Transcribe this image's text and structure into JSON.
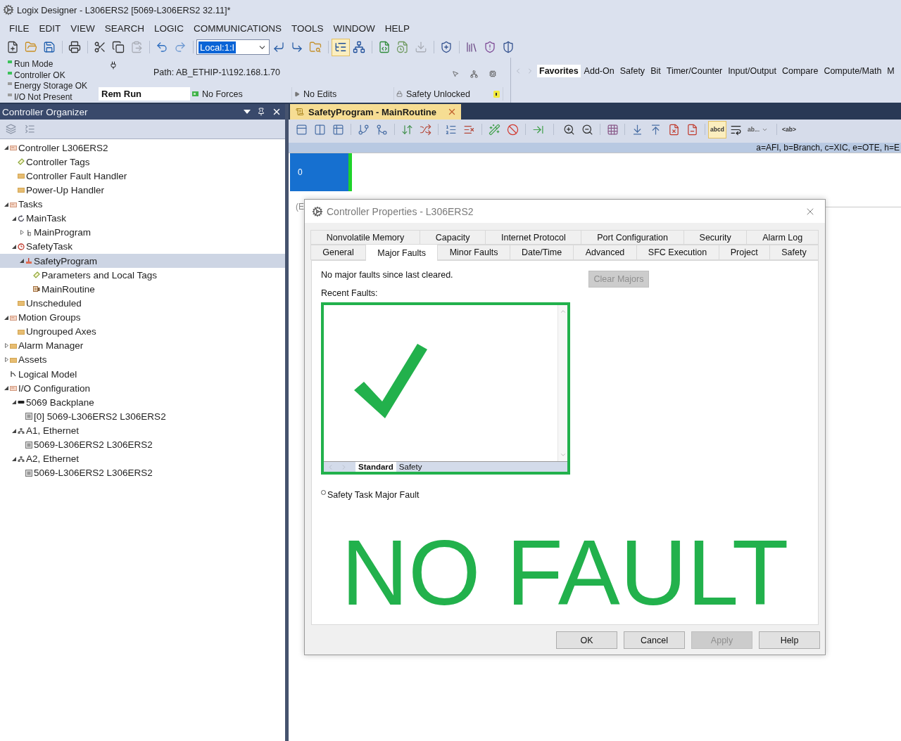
{
  "window": {
    "title": "Logix Designer - L306ERS2 [5069-L306ERS2 32.11]*"
  },
  "menu": [
    "FILE",
    "EDIT",
    "VIEW",
    "SEARCH",
    "LOGIC",
    "COMMUNICATIONS",
    "TOOLS",
    "WINDOW",
    "HELP"
  ],
  "toolbar": {
    "buttons": [
      {
        "selected": false,
        "disabled": false
      },
      {
        "selected": false,
        "disabled": false
      },
      {
        "selected": false,
        "disabled": false
      },
      {
        "selected": false,
        "disabled": false
      },
      {
        "selected": false,
        "disabled": false
      },
      {
        "selected": false,
        "disabled": false
      },
      {
        "selected": false,
        "disabled": true
      },
      {
        "selected": false,
        "disabled": false
      },
      {
        "selected": false,
        "disabled": false
      },
      {
        "selected": false,
        "disabled": false
      },
      {
        "selected": false,
        "disabled": false
      },
      {
        "selected": false,
        "disabled": false
      },
      {
        "selected": true,
        "disabled": false
      },
      {
        "selected": false,
        "disabled": false
      },
      {
        "selected": false,
        "disabled": false
      },
      {
        "selected": false,
        "disabled": false
      },
      {
        "selected": false,
        "disabled": true
      },
      {
        "selected": false,
        "disabled": false
      },
      {
        "selected": false,
        "disabled": false
      },
      {
        "selected": false,
        "disabled": false
      },
      {
        "selected": false,
        "disabled": false
      }
    ],
    "dropdown": {
      "value": "Local:1:I",
      "text_selected": true
    }
  },
  "status": {
    "lights": [
      {
        "label": "Run Mode",
        "color": "#3cc25a"
      },
      {
        "label": "Controller OK",
        "color": "#3cc25a"
      },
      {
        "label": "Energy Storage OK",
        "color": "#9c9c9c"
      },
      {
        "label": "I/O Not Present",
        "color": "#9c9c9c"
      }
    ],
    "path": "Path: AB_ETHIP-1\\192.168.1.70",
    "cells": [
      {
        "label": "Rem Run",
        "kind": "mode"
      },
      {
        "label": "No Forces",
        "kind": "forces"
      },
      {
        "label": "No Edits",
        "kind": "edits"
      },
      {
        "label": "Safety Unlocked",
        "kind": "safety"
      }
    ]
  },
  "palette": {
    "tabs": [
      {
        "label": "Favorites",
        "selected": true
      },
      {
        "label": "Add-On",
        "selected": false
      },
      {
        "label": "Safety",
        "selected": false
      },
      {
        "label": "Bit",
        "selected": false
      },
      {
        "label": "Timer/Counter",
        "selected": false
      },
      {
        "label": "Input/Output",
        "selected": false
      },
      {
        "label": "Compare",
        "selected": false
      },
      {
        "label": "Compute/Math",
        "selected": false
      },
      {
        "label": "M",
        "selected": false
      }
    ]
  },
  "organizer": {
    "title": "Controller Organizer",
    "tree": [
      {
        "label": "Controller L306ERS2",
        "kind": "controller",
        "expanded": true,
        "selected": false,
        "children": [
          {
            "label": "Controller Tags",
            "kind": "tags",
            "selected": false
          },
          {
            "label": "Controller Fault Handler",
            "kind": "folder",
            "selected": false
          },
          {
            "label": "Power-Up Handler",
            "kind": "folder",
            "selected": false
          }
        ]
      },
      {
        "label": "Tasks",
        "kind": "controller",
        "expanded": true,
        "selected": false,
        "children": [
          {
            "label": "MainTask",
            "kind": "task",
            "expanded": true,
            "selected": false,
            "children": [
              {
                "label": "MainProgram",
                "kind": "program",
                "expanded": false,
                "selected": false
              }
            ]
          },
          {
            "label": "SafetyTask",
            "kind": "safety_task",
            "expanded": true,
            "selected": false,
            "children": [
              {
                "label": "SafetyProgram",
                "kind": "safety_program",
                "expanded": true,
                "selected": true,
                "children": [
                  {
                    "label": "Parameters and Local Tags",
                    "kind": "tags",
                    "selected": false
                  },
                  {
                    "label": "MainRoutine",
                    "kind": "routine",
                    "selected": false
                  }
                ]
              }
            ]
          },
          {
            "label": "Unscheduled",
            "kind": "folder",
            "selected": false
          }
        ]
      },
      {
        "label": "Motion Groups",
        "kind": "controller",
        "expanded": true,
        "selected": false,
        "children": [
          {
            "label": "Ungrouped Axes",
            "kind": "folder",
            "selected": false
          }
        ]
      },
      {
        "label": "Alarm Manager",
        "kind": "folder",
        "expanded": false,
        "selected": false
      },
      {
        "label": "Assets",
        "kind": "folder",
        "expanded": false,
        "selected": false
      },
      {
        "label": "Logical Model",
        "kind": "model",
        "selected": false
      },
      {
        "label": "I/O Configuration",
        "kind": "controller",
        "expanded": true,
        "selected": false,
        "children": [
          {
            "label": "5069 Backplane",
            "kind": "backplane",
            "expanded": true,
            "selected": false,
            "children": [
              {
                "label": "[0] 5069-L306ERS2 L306ERS2",
                "kind": "module",
                "selected": false
              }
            ]
          },
          {
            "label": "A1, Ethernet",
            "kind": "network",
            "expanded": true,
            "selected": false,
            "children": [
              {
                "label": "5069-L306ERS2 L306ERS2",
                "kind": "module",
                "selected": false
              }
            ]
          },
          {
            "label": "A2, Ethernet",
            "kind": "network",
            "expanded": true,
            "selected": false,
            "children": [
              {
                "label": "5069-L306ERS2 L306ERS2",
                "kind": "module",
                "selected": false
              }
            ]
          }
        ]
      }
    ]
  },
  "editor": {
    "tab": {
      "label": "SafetyProgram - MainRoutine",
      "selected": true
    },
    "toolbar": [
      {
        "kind": "icon",
        "selected": false
      },
      {
        "kind": "icon",
        "selected": false
      },
      {
        "kind": "icon",
        "selected": false
      },
      {
        "kind": "icon",
        "selected": false
      },
      {
        "kind": "icon",
        "selected": false
      },
      {
        "kind": "icon",
        "selected": false
      },
      {
        "kind": "icon",
        "selected": false
      },
      {
        "kind": "icon",
        "selected": false
      },
      {
        "kind": "icon",
        "selected": false
      },
      {
        "kind": "icon",
        "selected": false
      },
      {
        "kind": "icon",
        "selected": false
      },
      {
        "kind": "icon",
        "selected": false
      },
      {
        "kind": "icon",
        "selected": false
      },
      {
        "kind": "icon",
        "selected": false
      },
      {
        "kind": "icon",
        "selected": false
      },
      {
        "kind": "icon",
        "selected": false
      },
      {
        "kind": "icon",
        "selected": false
      },
      {
        "kind": "icon",
        "selected": false
      },
      {
        "kind": "icon",
        "selected": false
      },
      {
        "kind": "text",
        "label": "abcd",
        "selected": true
      },
      {
        "kind": "icon",
        "selected": false
      },
      {
        "kind": "menu",
        "label": "ab...",
        "selected": false
      },
      {
        "kind": "text",
        "label": "<ab>",
        "selected": false
      }
    ],
    "legend": "a=AFI, b=Branch, c=XIC, e=OTE, h=E",
    "rung": {
      "number": "0"
    },
    "comment": "(E"
  },
  "dialog": {
    "title": "Controller Properties - L306ERS2",
    "tab_rows": [
      [
        {
          "label": "Nonvolatile Memory",
          "selected": false
        },
        {
          "label": "Capacity",
          "selected": false
        },
        {
          "label": "Internet Protocol",
          "selected": false
        },
        {
          "label": "Port Configuration",
          "selected": false
        },
        {
          "label": "Security",
          "selected": false
        },
        {
          "label": "Alarm Log",
          "selected": false
        }
      ],
      [
        {
          "label": "General",
          "selected": false
        },
        {
          "label": "Major Faults",
          "selected": true
        },
        {
          "label": "Minor Faults",
          "selected": false
        },
        {
          "label": "Date/Time",
          "selected": false
        },
        {
          "label": "Advanced",
          "selected": false
        },
        {
          "label": "SFC Execution",
          "selected": false
        },
        {
          "label": "Project",
          "selected": false
        },
        {
          "label": "Safety",
          "selected": false
        }
      ]
    ],
    "message": "No major faults since last cleared.",
    "clear_button": {
      "label": "Clear Majors",
      "disabled": true
    },
    "recent_label": "Recent Faults:",
    "fault_tabs": [
      {
        "label": "Standard",
        "selected": true
      },
      {
        "label": "Safety",
        "selected": false
      }
    ],
    "safety_fault": {
      "label": "Safety Task Major Fault",
      "on": false
    },
    "banner": "NO FAULT",
    "buttons": [
      {
        "label": "OK",
        "disabled": false
      },
      {
        "label": "Cancel",
        "disabled": false
      },
      {
        "label": "Apply",
        "disabled": true
      },
      {
        "label": "Help",
        "disabled": false
      }
    ]
  }
}
